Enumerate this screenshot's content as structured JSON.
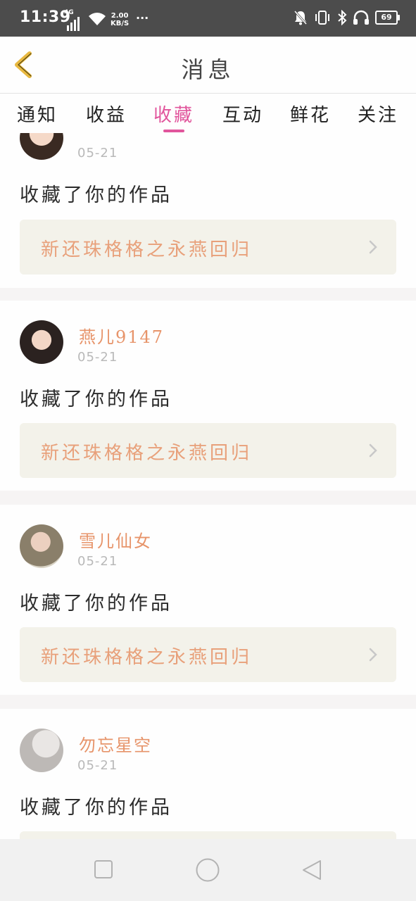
{
  "status_bar": {
    "time": "11:39",
    "network": "4G",
    "speed_value": "2.00",
    "speed_unit": "KB/S",
    "more": "···",
    "battery": "69"
  },
  "header": {
    "title": "消息"
  },
  "tabs": [
    {
      "label": "通知",
      "active": false
    },
    {
      "label": "收益",
      "active": false
    },
    {
      "label": "收藏",
      "active": true
    },
    {
      "label": "互动",
      "active": false
    },
    {
      "label": "鲜花",
      "active": false
    },
    {
      "label": "关注",
      "active": false
    }
  ],
  "feed": [
    {
      "username": "",
      "date": "05-21",
      "action": "收藏了你的作品",
      "work_title": "新还珠格格之永燕回归"
    },
    {
      "username": "燕儿9147",
      "date": "05-21",
      "action": "收藏了你的作品",
      "work_title": "新还珠格格之永燕回归"
    },
    {
      "username": "雪儿仙女",
      "date": "05-21",
      "action": "收藏了你的作品",
      "work_title": "新还珠格格之永燕回归"
    },
    {
      "username": "勿忘星空",
      "date": "05-21",
      "action": "收藏了你的作品",
      "work_title": ""
    }
  ],
  "colors": {
    "accent": "#e1559c",
    "username": "#e7946a",
    "work_title": "#e8a07a",
    "back_arrow": "#e8b840"
  },
  "icons": {
    "back": "chevron-left-icon",
    "work_link": "chevron-right-icon",
    "nav": [
      "recent-apps-icon",
      "home-icon",
      "back-triangle-icon"
    ]
  }
}
